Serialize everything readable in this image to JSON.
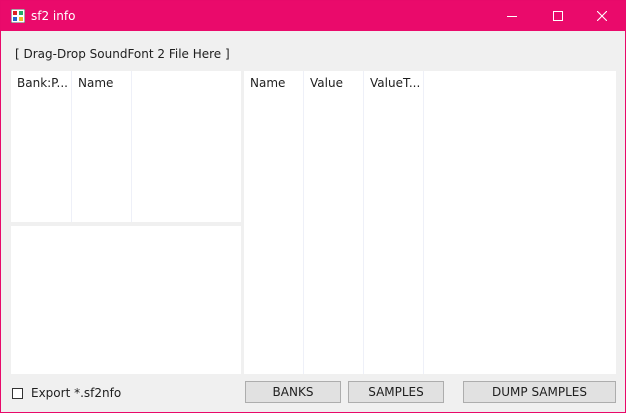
{
  "window": {
    "title": "sf2 info",
    "icon": "app-grid-icon",
    "titlebar_color": "#ea0a6b"
  },
  "drop_label": "[ Drag-Drop SoundFont 2 File Here ]",
  "banks_list": {
    "columns": [
      "Bank:P...",
      "Name"
    ]
  },
  "props_list": {
    "columns": [
      "Name",
      "Value",
      "ValueT..."
    ]
  },
  "export_checkbox": {
    "label": "Export *.sf2nfo",
    "checked": false
  },
  "buttons": {
    "banks": "BANKS",
    "samples": "SAMPLES",
    "dump_samples": "DUMP SAMPLES"
  }
}
